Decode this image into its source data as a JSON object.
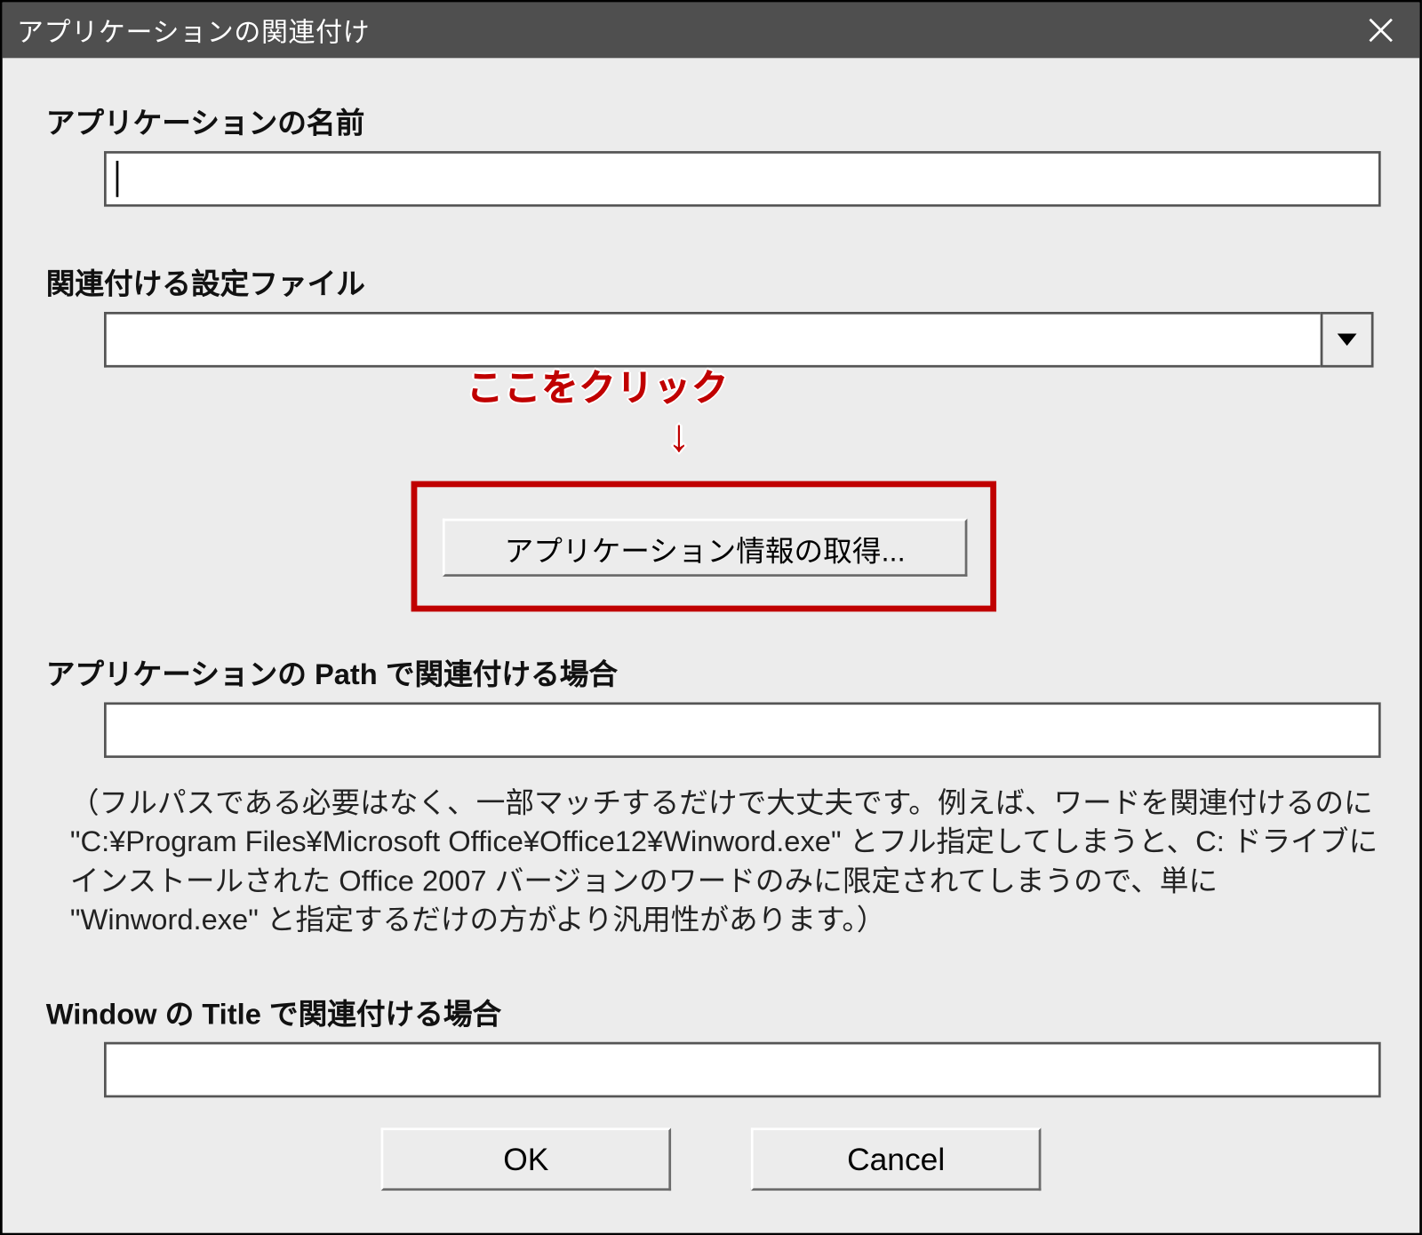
{
  "window": {
    "title": "アプリケーションの関連付け"
  },
  "callout": {
    "text": "ここをクリック",
    "arrow": "↓"
  },
  "sections": {
    "app_name": {
      "label": "アプリケーションの名前",
      "value": ""
    },
    "settings_file": {
      "label": "関連付ける設定ファイル",
      "value": ""
    },
    "get_info_button": "アプリケーション情報の取得...",
    "app_path": {
      "label": "アプリケーションの Path で関連付ける場合",
      "value": "",
      "note": "（フルパスである必要はなく、一部マッチするだけで大丈夫です。例えば、ワードを関連付けるのに \"C:¥Program Files¥Microsoft Office¥Office12¥Winword.exe\" とフル指定してしまうと、C: ドライブにインストールされた Office 2007 バージョンのワードのみに限定されてしまうので、単に  \"Winword.exe\" と指定するだけの方がより汎用性があります。）"
    },
    "window_title": {
      "label": "Window の Title で関連付ける場合",
      "value": ""
    }
  },
  "buttons": {
    "ok": "OK",
    "cancel": "Cancel"
  }
}
